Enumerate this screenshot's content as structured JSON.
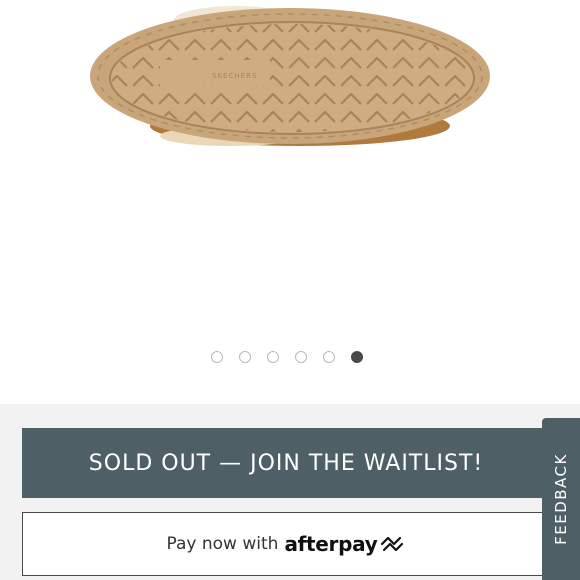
{
  "product": {
    "image_alt": "slipper-sole-image"
  },
  "carousel": {
    "total": 6,
    "active_index": 6
  },
  "actions": {
    "waitlist_label": "SOLD OUT — JOIN THE WAITLIST!",
    "pay_now_label": "Pay now with",
    "afterpay_brand": "afterpay"
  },
  "feedback": {
    "label": "FEEDBACK"
  },
  "colors": {
    "primary_button": "#4e5f66",
    "sole": "#c9a57a",
    "suede": "#b07a3e",
    "active_dot": "#4a4a4a"
  },
  "icons": {
    "afterpay_logo": "afterpay-arrows-icon"
  }
}
